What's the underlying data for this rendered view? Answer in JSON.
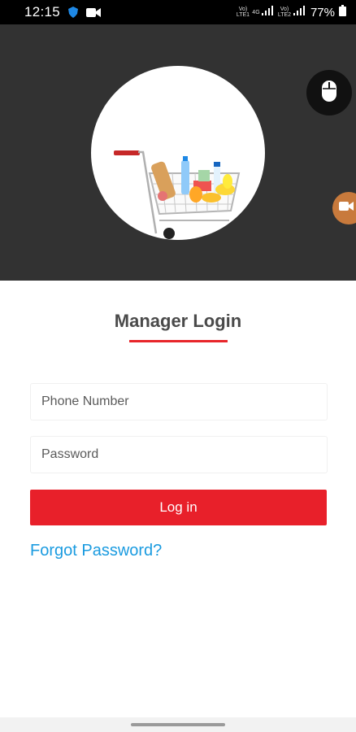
{
  "status_bar": {
    "time": "12:15",
    "net1_label": "Vo) LTE1",
    "net2_label": "4G",
    "net3_label": "Vo) LTE2",
    "battery": "77%"
  },
  "login": {
    "title": "Manager Login",
    "phone_placeholder": "Phone Number",
    "password_placeholder": "Password",
    "login_label": "Log in",
    "forgot_label": "Forgot Password?"
  },
  "colors": {
    "accent": "#e8202a",
    "link": "#1a9be0",
    "header_bg": "#323232"
  },
  "icons": [
    "shield-icon",
    "video-icon",
    "signal-icon",
    "battery-icon",
    "mouse-icon",
    "shopping-cart-icon"
  ]
}
